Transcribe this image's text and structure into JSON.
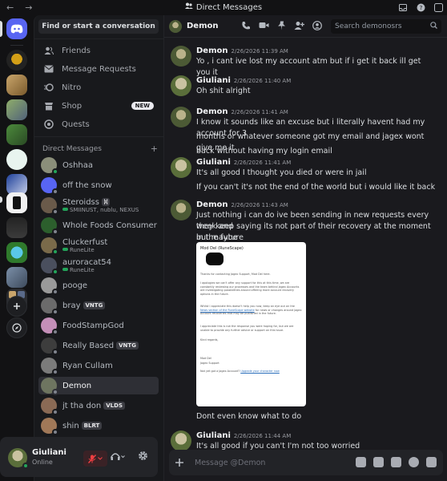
{
  "titlebar": {
    "back": "←",
    "forward": "→",
    "title": "Direct Messages"
  },
  "sidebar": {
    "search_label": "Find or start a conversation",
    "nav": [
      {
        "label": "Friends",
        "icon": "friends-icon"
      },
      {
        "label": "Message Requests",
        "icon": "envelope-icon"
      },
      {
        "label": "Nitro",
        "icon": "nitro-icon"
      },
      {
        "label": "Shop",
        "icon": "shop-icon",
        "badge": "NEW"
      },
      {
        "label": "Quests",
        "icon": "quests-icon"
      }
    ],
    "dm_header": "Direct Messages",
    "dm_add": "+",
    "dms": [
      {
        "name": "Oshhaa",
        "color": "#8b8f7a",
        "status": "#23a55a"
      },
      {
        "name": "off the snow",
        "color": "#5865f2",
        "status": "#80848e"
      },
      {
        "name": "Steroidss",
        "tag": "ᛞ",
        "sub": "SMIINUST, nublu, NEXUS",
        "color": "#6a5a4a",
        "status": "#80848e"
      },
      {
        "name": "Whole Foods Consumer …",
        "color": "#2c5f2d",
        "status": "#80848e"
      },
      {
        "name": "Cluckerfust",
        "sub": "RuneLite",
        "color": "#7a6a4a",
        "status": "#23a55a"
      },
      {
        "name": "auroracat54",
        "sub": "RuneLite",
        "color": "#4a4f5e",
        "status": "#23a55a"
      },
      {
        "name": "pooge",
        "color": "#9a9a9a",
        "status": "#80848e"
      },
      {
        "name": "bray",
        "tag": "VNTG",
        "color": "#6b6b6b",
        "status": "#80848e"
      },
      {
        "name": "FoodStampGod",
        "color": "#c48fb8",
        "status": "#80848e"
      },
      {
        "name": "Really Based",
        "tag": "VNTG",
        "color": "#3d3d3d",
        "status": "#80848e"
      },
      {
        "name": "Ryan Cullam",
        "color": "#7b7b7b",
        "status": "#80848e"
      },
      {
        "name": "Demon",
        "color": "#6e7560",
        "status": "#80848e",
        "active": true
      },
      {
        "name": "jt tha don",
        "tag": "VLDS",
        "color": "#8a6a55",
        "status": "#80848e"
      },
      {
        "name": "shin",
        "tag": "BLRT",
        "color": "#a07858",
        "status": "#80848e"
      }
    ]
  },
  "user_panel": {
    "name": "Giuliani",
    "status": "Online"
  },
  "chat": {
    "recipient": "Demon",
    "search_placeholder": "Search demonosrs",
    "composer_placeholder": "Message @Demon",
    "messages": [
      {
        "author": "Demon",
        "time": "2/26/2026 11:39 AM",
        "lines": [
          "Yo , i cant ive lost my account atm but if i get it back ill get you it"
        ]
      },
      {
        "author": "Giuliani",
        "time": "2/26/2026 11:40 AM",
        "lines": [
          "Oh shit alright"
        ]
      },
      {
        "author": "Demon",
        "time": "2/26/2026 11:41 AM",
        "lines": [
          "I know it sounds like an excuse but i literally havent had my account for 3",
          "months or whatever someone got my email and jagex wont give me it",
          "back without having my login email"
        ]
      },
      {
        "author": "Giuliani",
        "time": "2/26/2026 11:41 AM",
        "lines": [
          "It's all good I thought you died or were in jail",
          "If you can't it's not the end of the world but i would like it back"
        ]
      },
      {
        "author": "Demon",
        "time": "2/26/2026 11:43 AM",
        "lines": [
          "Just nothing i can do ive been sending in new requests every week and",
          "they keep saying its not part of their recovery at the moment but maybe",
          "in the future"
        ],
        "after": "Dont even know what to do"
      },
      {
        "author": "Giuliani",
        "time": "2/26/2026 11:44 AM",
        "lines": [
          "It's all good if you can't I'm not too worried"
        ]
      }
    ],
    "attachment": {
      "from": "Mod Del (RuneScape)",
      "paragraphs": [
        "Thanks for contacting Jagex Support, Mod Del here.",
        "I apologies we can't offer any support for this at this time, we are constantly reviewing our processes and the team behind Jagex Accounts are investigating possibilities around offering more account recovery options in the future.",
        "Whilst I appreciate this doesn't help you now, keep an eye out on the",
        "changes around Jagex Account recoveries that may be published in the future.",
        "I appreciate this is not the response you were hoping for, but we are unable to provide any further advice or support on this issue.",
        "Kind regards,",
        "Mod Del",
        "Jagex Support",
        "Not yet got a Jagex Account?"
      ],
      "link1": "News section of the RuneScape website",
      "link1_tail": "for news or",
      "link2": "Upgrade your character now"
    }
  }
}
